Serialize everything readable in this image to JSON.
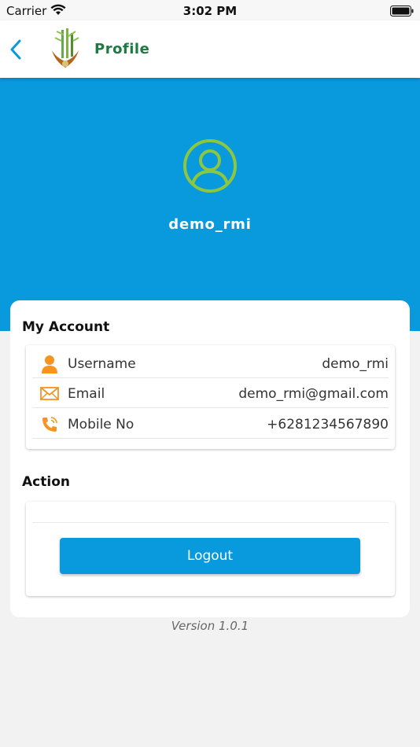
{
  "status_bar": {
    "carrier": "Carrier",
    "time": "3:02 PM"
  },
  "header": {
    "title": "Profile",
    "back_icon": "chevron-left-icon"
  },
  "profile": {
    "username": "demo_rmi",
    "avatar_icon": "user-circle-icon"
  },
  "account": {
    "section_title": "My Account",
    "rows": [
      {
        "icon": "person-icon",
        "label": "Username",
        "value": "demo_rmi"
      },
      {
        "icon": "mail-icon",
        "label": "Email",
        "value": "demo_rmi@gmail.com"
      },
      {
        "icon": "phone-icon",
        "label": "Mobile No",
        "value": "+6281234567890"
      }
    ]
  },
  "action": {
    "section_title": "Action",
    "logout_label": "Logout"
  },
  "footer": {
    "version": "Version 1.0.1"
  },
  "colors": {
    "primary": "#0999dd",
    "brand_green": "#1e7a43",
    "accent_orange": "#f7931e",
    "avatar_green": "#8dc63f"
  }
}
